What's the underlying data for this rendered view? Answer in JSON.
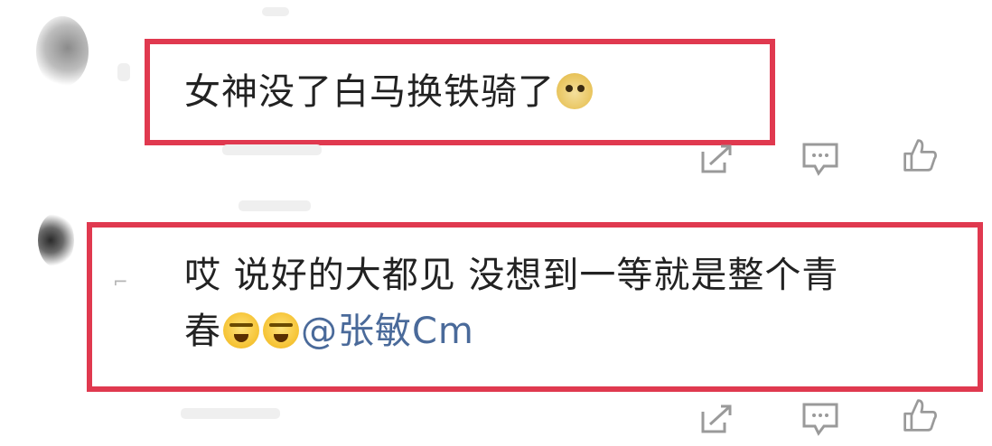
{
  "comments": [
    {
      "text": "女神没了白马换铁骑了",
      "emoji": "doge-icon"
    },
    {
      "line1": "哎 说好的大都见 没想到一等就是整个青",
      "line2_prefix": "春",
      "mention": "@张敏Cm",
      "emoji": "cry-icon"
    }
  ],
  "colors": {
    "highlight_border": "#e0394f",
    "mention": "#4a6a9a",
    "icon": "#9a9a9a"
  },
  "icons": [
    "share-icon",
    "comment-icon",
    "like-icon"
  ]
}
